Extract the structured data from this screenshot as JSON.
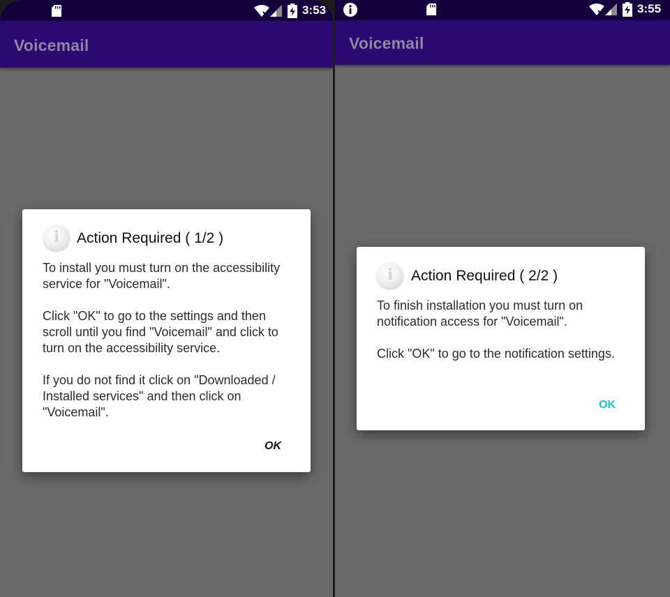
{
  "colors": {
    "status_bar": "#13003d",
    "app_bar": "#2a0a70",
    "app_title": "#8f87a3",
    "scrim": "#6a6a6a",
    "ok_left": "#111111",
    "ok_right": "#19c2c9"
  },
  "left": {
    "status": {
      "time": "3:53",
      "icons": [
        "sd-card-icon",
        "wifi-icon",
        "signal-icon",
        "battery-charging-icon"
      ]
    },
    "app_title": "Voicemail",
    "dialog": {
      "icon": "info-icon",
      "title": "Action Required ( 1/2 )",
      "paragraphs": [
        "To install you must turn on the accessibility service for \"Voicemail\".",
        "Click \"OK\" to go to the settings and then scroll until you find \"Voicemail\" and click to turn on the accessibility service.",
        "If you do not find it click on \"Downloaded / Installed services\" and then click on \"Voicemail\"."
      ],
      "ok_label": "OK"
    }
  },
  "right": {
    "status": {
      "time": "3:55",
      "icons": [
        "info-notification-icon",
        "sd-card-icon",
        "wifi-icon",
        "signal-icon",
        "battery-charging-icon"
      ]
    },
    "app_title": "Voicemail",
    "dialog": {
      "icon": "info-icon",
      "title": "Action Required ( 2/2 )",
      "paragraphs": [
        "To finish installation you must turn on notification access for \"Voicemail\".",
        "Click \"OK\" to go to the notification settings."
      ],
      "ok_label": "OK"
    }
  }
}
